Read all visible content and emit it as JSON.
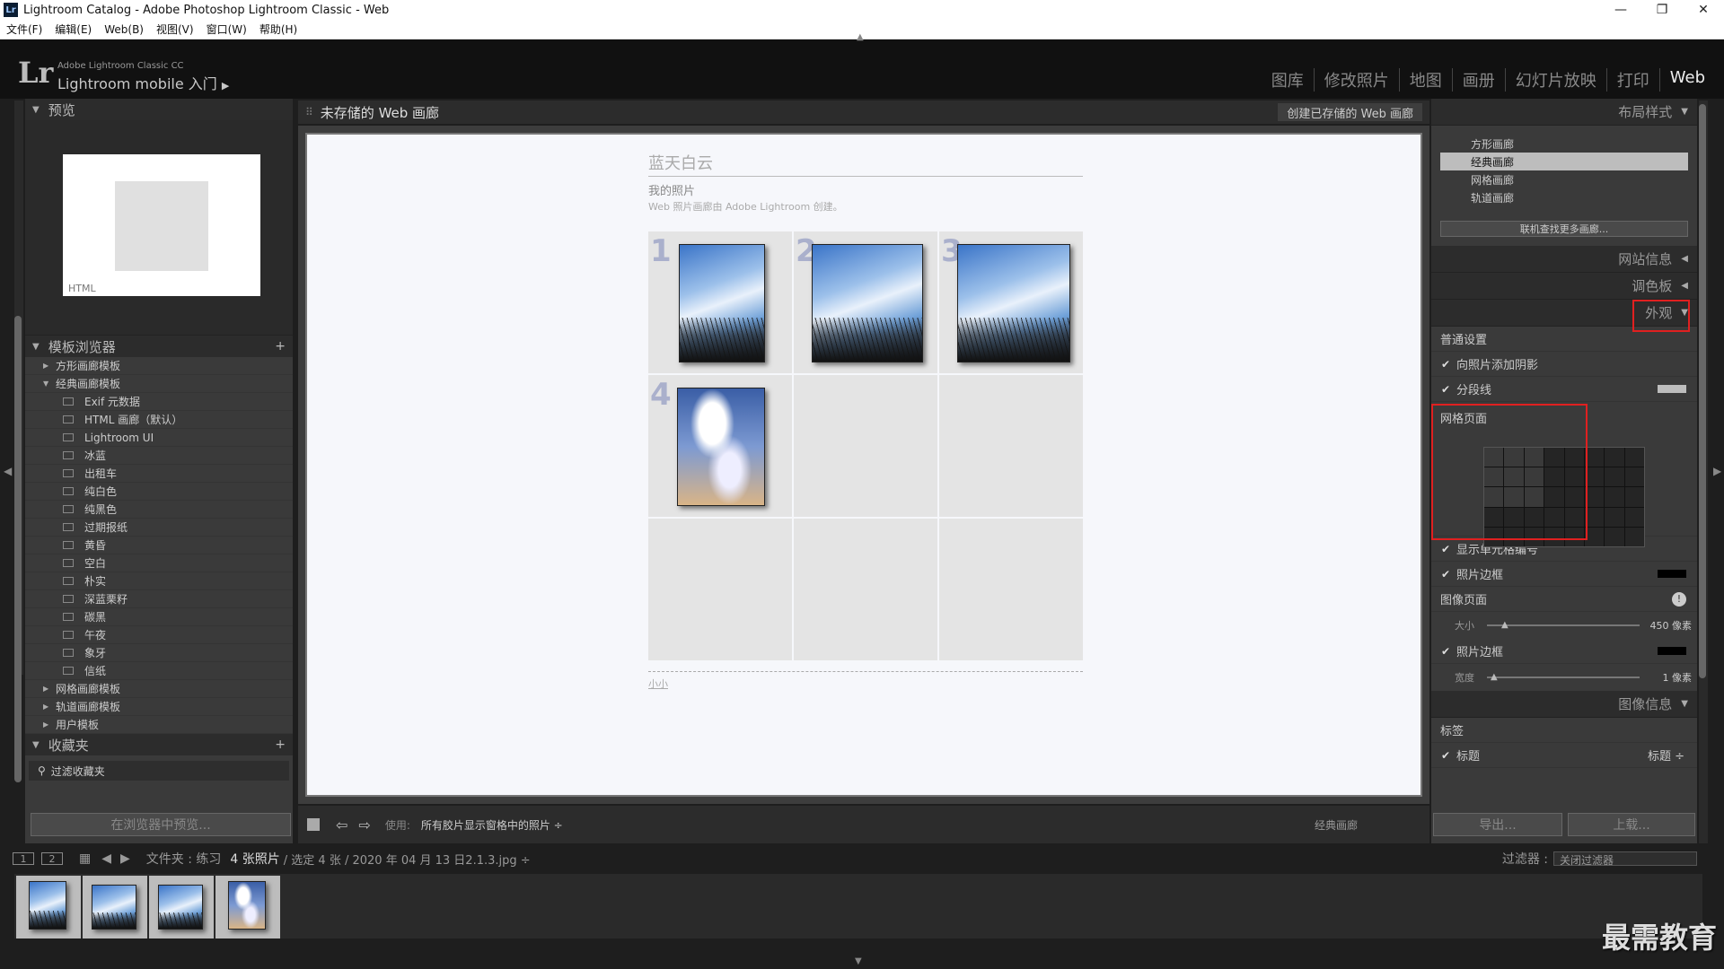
{
  "window": {
    "title": "Lightroom Catalog - Adobe Photoshop Lightroom Classic - Web",
    "app_icon": "Lr",
    "controls": [
      "—",
      "❐",
      "✕"
    ]
  },
  "menu": [
    "文件(F)",
    "编辑(E)",
    "Web(B)",
    "视图(V)",
    "窗口(W)",
    "帮助(H)"
  ],
  "identity": {
    "logo": "Lr",
    "product": "Adobe Lightroom Classic CC",
    "mobile": "Lightroom mobile 入门"
  },
  "modules": [
    "图库",
    "修改照片",
    "地图",
    "画册",
    "幻灯片放映",
    "打印",
    "Web"
  ],
  "left": {
    "preview_header": "预览",
    "preview_badge": "HTML",
    "template_header": "模板浏览器",
    "templates": [
      {
        "label": "方形画廊模板",
        "expanded": false
      },
      {
        "label": "经典画廊模板",
        "expanded": true
      }
    ],
    "classic_children": [
      "Exif 元数据",
      "HTML 画廊（默认）",
      "Lightroom UI",
      "冰蓝",
      "出租车",
      "纯白色",
      "纯黑色",
      "过期报纸",
      "黄昏",
      "空白",
      "朴实",
      "深蓝栗籽",
      "碳黑",
      "午夜",
      "象牙",
      "信纸"
    ],
    "more_templates": [
      "网格画廊模板",
      "轨道画廊模板",
      "用户模板"
    ],
    "collections_header": "收藏夹",
    "collections_filter": "过滤收藏夹",
    "preview_btn": "在浏览器中预览..."
  },
  "center": {
    "title": "未存储的 Web 画廊",
    "save_btn": "创建已存储的 Web 画廊",
    "site_title": "蓝天白云",
    "site_subtitle": "我的照片",
    "site_desc": "Web 照片画廊由 Adobe Lightroom 创建。",
    "cells": [
      "1",
      "2",
      "3",
      "4"
    ],
    "footer_link": "小小",
    "toolbar_use_label": "使用:",
    "toolbar_use_value": "所有胶片显示窗格中的照片 ÷",
    "toolbar_right": "经典画廊"
  },
  "right": {
    "layout_header": "布局样式",
    "layouts": [
      "方形画廊",
      "经典画廊",
      "网格画廊",
      "轨道画廊"
    ],
    "selected_layout": 1,
    "find_more": "联机查找更多画廊...",
    "site_info": "网站信息",
    "palette": "调色板",
    "appearance": "外观",
    "general": "普通设置",
    "add_shadow": "向照片添加阴影",
    "section_lines": "分段线",
    "grid_page": "网格页面",
    "show_cell_numbers": "显示单元格编号",
    "photo_border": "照片边框",
    "image_page": "图像页面",
    "size_label": "大小",
    "size_value": "450 像素",
    "photo_border2": "照片边框",
    "width_label": "宽度",
    "width_value": "1 像素",
    "image_info": "图像信息",
    "tags": "标签",
    "title_label": "标题",
    "title_value": "标题 ÷",
    "export_btn": "导出...",
    "upload_btn": "上载..."
  },
  "filmbar": {
    "page1": "1",
    "page2": "2",
    "folder": "文件夹 : 练习",
    "count": "4 张照片",
    "selection": "/ 选定 4 张 / 2020 年 04 月 13 日2.1.3.jpg ÷",
    "filter_label": "过滤器 :",
    "filter_value": "关闭过滤器"
  },
  "watermark": "最需教育",
  "colors": {
    "accent": "#e02020",
    "active_module": "#eeeeee",
    "panel_bg": "#3a3a3a"
  }
}
